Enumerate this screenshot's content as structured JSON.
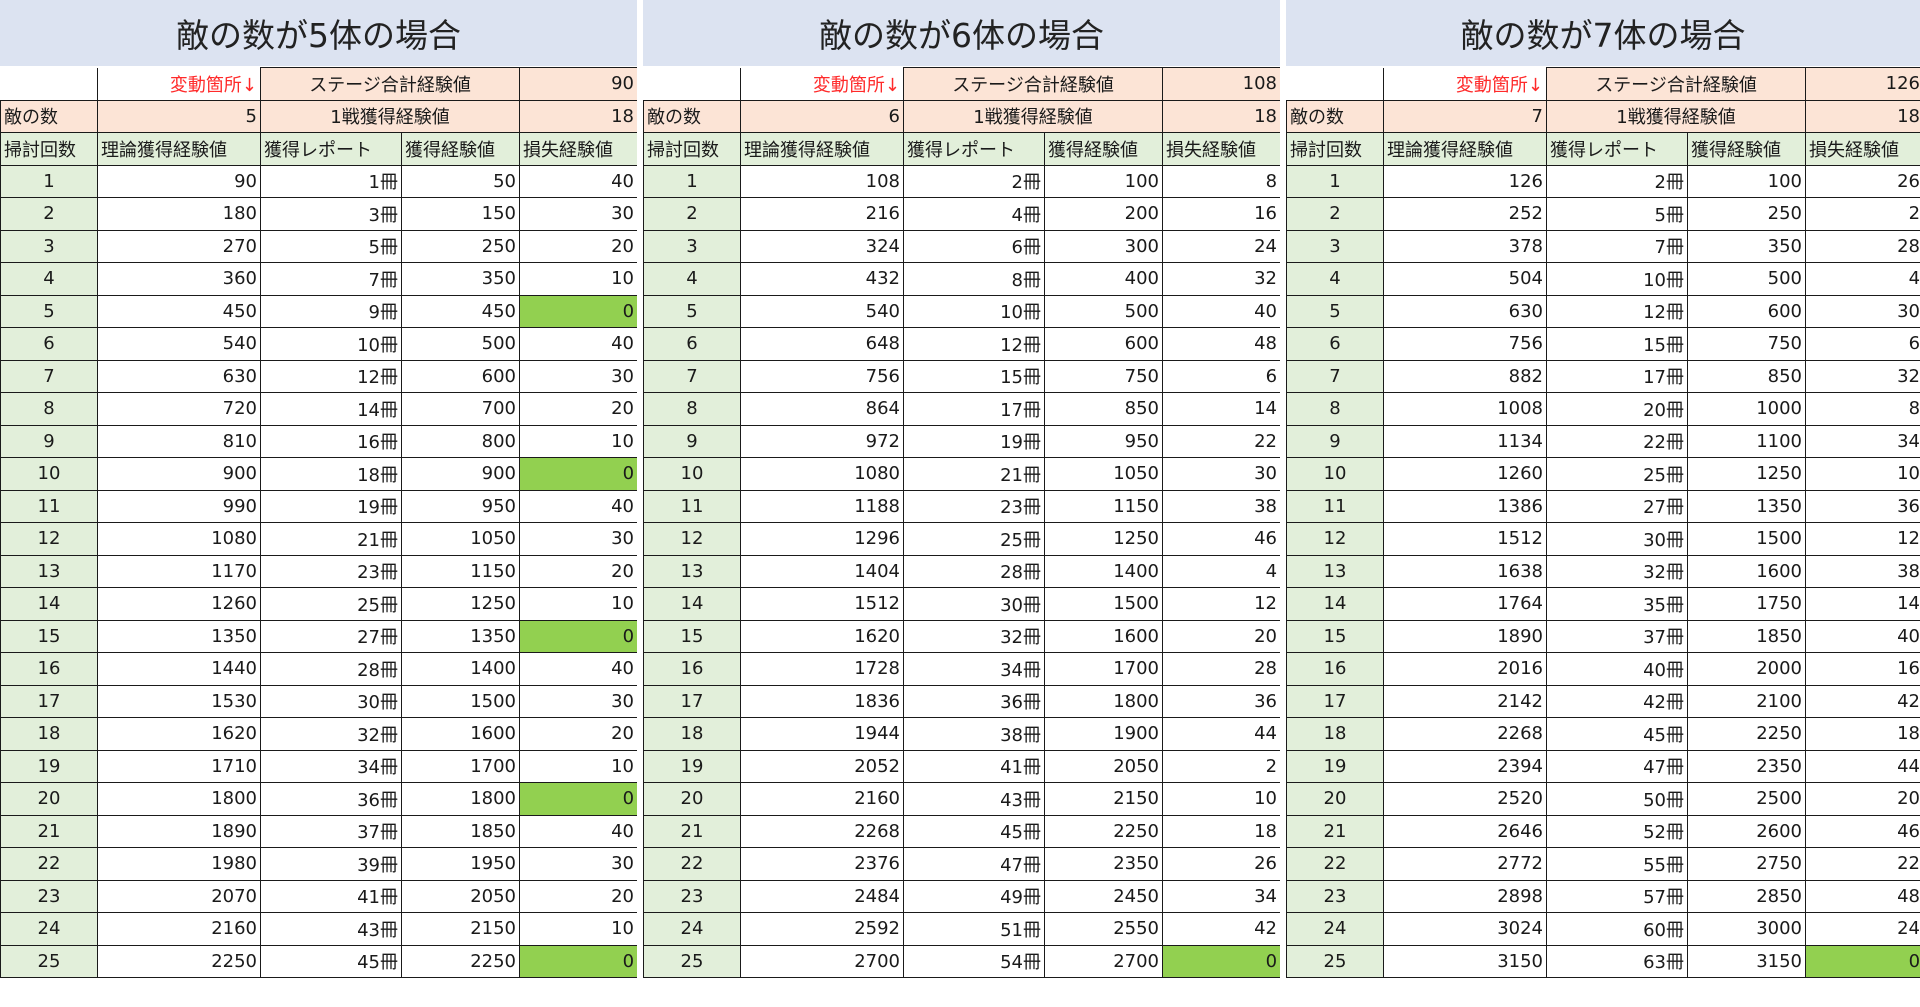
{
  "labels": {
    "variable_note": "変動箇所↓",
    "stage_total_label": "ステージ合計経験値",
    "enemy_count_label": "敵の数",
    "per_battle_label": "1戦獲得経験値",
    "col_sweeps": "掃討回数",
    "col_theory_exp": "理論獲得経験値",
    "col_reports": "獲得レポート",
    "col_gained_exp": "獲得経験値",
    "col_lost_exp": "損失経験値",
    "report_unit": "冊"
  },
  "colors": {
    "header_band": "#dce3f1",
    "label_fill": "#fce4d6",
    "index_fill": "#e2efda",
    "zero_loss_highlight": "#92d050",
    "note_text": "#ff2a2a"
  },
  "tables": [
    {
      "title": "敵の数が5体の場合",
      "stage_total": "90",
      "enemy_count": "5",
      "per_battle": "18",
      "rows": [
        {
          "sweeps": "1",
          "theory": "90",
          "reports": "1",
          "gained": "50",
          "lost": "40",
          "zero": false
        },
        {
          "sweeps": "2",
          "theory": "180",
          "reports": "3",
          "gained": "150",
          "lost": "30",
          "zero": false
        },
        {
          "sweeps": "3",
          "theory": "270",
          "reports": "5",
          "gained": "250",
          "lost": "20",
          "zero": false
        },
        {
          "sweeps": "4",
          "theory": "360",
          "reports": "7",
          "gained": "350",
          "lost": "10",
          "zero": false
        },
        {
          "sweeps": "5",
          "theory": "450",
          "reports": "9",
          "gained": "450",
          "lost": "0",
          "zero": true
        },
        {
          "sweeps": "6",
          "theory": "540",
          "reports": "10",
          "gained": "500",
          "lost": "40",
          "zero": false
        },
        {
          "sweeps": "7",
          "theory": "630",
          "reports": "12",
          "gained": "600",
          "lost": "30",
          "zero": false
        },
        {
          "sweeps": "8",
          "theory": "720",
          "reports": "14",
          "gained": "700",
          "lost": "20",
          "zero": false
        },
        {
          "sweeps": "9",
          "theory": "810",
          "reports": "16",
          "gained": "800",
          "lost": "10",
          "zero": false
        },
        {
          "sweeps": "10",
          "theory": "900",
          "reports": "18",
          "gained": "900",
          "lost": "0",
          "zero": true
        },
        {
          "sweeps": "11",
          "theory": "990",
          "reports": "19",
          "gained": "950",
          "lost": "40",
          "zero": false
        },
        {
          "sweeps": "12",
          "theory": "1080",
          "reports": "21",
          "gained": "1050",
          "lost": "30",
          "zero": false
        },
        {
          "sweeps": "13",
          "theory": "1170",
          "reports": "23",
          "gained": "1150",
          "lost": "20",
          "zero": false
        },
        {
          "sweeps": "14",
          "theory": "1260",
          "reports": "25",
          "gained": "1250",
          "lost": "10",
          "zero": false
        },
        {
          "sweeps": "15",
          "theory": "1350",
          "reports": "27",
          "gained": "1350",
          "lost": "0",
          "zero": true
        },
        {
          "sweeps": "16",
          "theory": "1440",
          "reports": "28",
          "gained": "1400",
          "lost": "40",
          "zero": false
        },
        {
          "sweeps": "17",
          "theory": "1530",
          "reports": "30",
          "gained": "1500",
          "lost": "30",
          "zero": false
        },
        {
          "sweeps": "18",
          "theory": "1620",
          "reports": "32",
          "gained": "1600",
          "lost": "20",
          "zero": false
        },
        {
          "sweeps": "19",
          "theory": "1710",
          "reports": "34",
          "gained": "1700",
          "lost": "10",
          "zero": false
        },
        {
          "sweeps": "20",
          "theory": "1800",
          "reports": "36",
          "gained": "1800",
          "lost": "0",
          "zero": true
        },
        {
          "sweeps": "21",
          "theory": "1890",
          "reports": "37",
          "gained": "1850",
          "lost": "40",
          "zero": false
        },
        {
          "sweeps": "22",
          "theory": "1980",
          "reports": "39",
          "gained": "1950",
          "lost": "30",
          "zero": false
        },
        {
          "sweeps": "23",
          "theory": "2070",
          "reports": "41",
          "gained": "2050",
          "lost": "20",
          "zero": false
        },
        {
          "sweeps": "24",
          "theory": "2160",
          "reports": "43",
          "gained": "2150",
          "lost": "10",
          "zero": false
        },
        {
          "sweeps": "25",
          "theory": "2250",
          "reports": "45",
          "gained": "2250",
          "lost": "0",
          "zero": true
        }
      ]
    },
    {
      "title": "敵の数が6体の場合",
      "stage_total": "108",
      "enemy_count": "6",
      "per_battle": "18",
      "rows": [
        {
          "sweeps": "1",
          "theory": "108",
          "reports": "2",
          "gained": "100",
          "lost": "8",
          "zero": false
        },
        {
          "sweeps": "2",
          "theory": "216",
          "reports": "4",
          "gained": "200",
          "lost": "16",
          "zero": false
        },
        {
          "sweeps": "3",
          "theory": "324",
          "reports": "6",
          "gained": "300",
          "lost": "24",
          "zero": false
        },
        {
          "sweeps": "4",
          "theory": "432",
          "reports": "8",
          "gained": "400",
          "lost": "32",
          "zero": false
        },
        {
          "sweeps": "5",
          "theory": "540",
          "reports": "10",
          "gained": "500",
          "lost": "40",
          "zero": false
        },
        {
          "sweeps": "6",
          "theory": "648",
          "reports": "12",
          "gained": "600",
          "lost": "48",
          "zero": false
        },
        {
          "sweeps": "7",
          "theory": "756",
          "reports": "15",
          "gained": "750",
          "lost": "6",
          "zero": false
        },
        {
          "sweeps": "8",
          "theory": "864",
          "reports": "17",
          "gained": "850",
          "lost": "14",
          "zero": false
        },
        {
          "sweeps": "9",
          "theory": "972",
          "reports": "19",
          "gained": "950",
          "lost": "22",
          "zero": false
        },
        {
          "sweeps": "10",
          "theory": "1080",
          "reports": "21",
          "gained": "1050",
          "lost": "30",
          "zero": false
        },
        {
          "sweeps": "11",
          "theory": "1188",
          "reports": "23",
          "gained": "1150",
          "lost": "38",
          "zero": false
        },
        {
          "sweeps": "12",
          "theory": "1296",
          "reports": "25",
          "gained": "1250",
          "lost": "46",
          "zero": false
        },
        {
          "sweeps": "13",
          "theory": "1404",
          "reports": "28",
          "gained": "1400",
          "lost": "4",
          "zero": false
        },
        {
          "sweeps": "14",
          "theory": "1512",
          "reports": "30",
          "gained": "1500",
          "lost": "12",
          "zero": false
        },
        {
          "sweeps": "15",
          "theory": "1620",
          "reports": "32",
          "gained": "1600",
          "lost": "20",
          "zero": false
        },
        {
          "sweeps": "16",
          "theory": "1728",
          "reports": "34",
          "gained": "1700",
          "lost": "28",
          "zero": false
        },
        {
          "sweeps": "17",
          "theory": "1836",
          "reports": "36",
          "gained": "1800",
          "lost": "36",
          "zero": false
        },
        {
          "sweeps": "18",
          "theory": "1944",
          "reports": "38",
          "gained": "1900",
          "lost": "44",
          "zero": false
        },
        {
          "sweeps": "19",
          "theory": "2052",
          "reports": "41",
          "gained": "2050",
          "lost": "2",
          "zero": false
        },
        {
          "sweeps": "20",
          "theory": "2160",
          "reports": "43",
          "gained": "2150",
          "lost": "10",
          "zero": false
        },
        {
          "sweeps": "21",
          "theory": "2268",
          "reports": "45",
          "gained": "2250",
          "lost": "18",
          "zero": false
        },
        {
          "sweeps": "22",
          "theory": "2376",
          "reports": "47",
          "gained": "2350",
          "lost": "26",
          "zero": false
        },
        {
          "sweeps": "23",
          "theory": "2484",
          "reports": "49",
          "gained": "2450",
          "lost": "34",
          "zero": false
        },
        {
          "sweeps": "24",
          "theory": "2592",
          "reports": "51",
          "gained": "2550",
          "lost": "42",
          "zero": false
        },
        {
          "sweeps": "25",
          "theory": "2700",
          "reports": "54",
          "gained": "2700",
          "lost": "0",
          "zero": true
        }
      ]
    },
    {
      "title": "敵の数が7体の場合",
      "stage_total": "126",
      "enemy_count": "7",
      "per_battle": "18",
      "rows": [
        {
          "sweeps": "1",
          "theory": "126",
          "reports": "2",
          "gained": "100",
          "lost": "26",
          "zero": false
        },
        {
          "sweeps": "2",
          "theory": "252",
          "reports": "5",
          "gained": "250",
          "lost": "2",
          "zero": false
        },
        {
          "sweeps": "3",
          "theory": "378",
          "reports": "7",
          "gained": "350",
          "lost": "28",
          "zero": false
        },
        {
          "sweeps": "4",
          "theory": "504",
          "reports": "10",
          "gained": "500",
          "lost": "4",
          "zero": false
        },
        {
          "sweeps": "5",
          "theory": "630",
          "reports": "12",
          "gained": "600",
          "lost": "30",
          "zero": false
        },
        {
          "sweeps": "6",
          "theory": "756",
          "reports": "15",
          "gained": "750",
          "lost": "6",
          "zero": false
        },
        {
          "sweeps": "7",
          "theory": "882",
          "reports": "17",
          "gained": "850",
          "lost": "32",
          "zero": false
        },
        {
          "sweeps": "8",
          "theory": "1008",
          "reports": "20",
          "gained": "1000",
          "lost": "8",
          "zero": false
        },
        {
          "sweeps": "9",
          "theory": "1134",
          "reports": "22",
          "gained": "1100",
          "lost": "34",
          "zero": false
        },
        {
          "sweeps": "10",
          "theory": "1260",
          "reports": "25",
          "gained": "1250",
          "lost": "10",
          "zero": false
        },
        {
          "sweeps": "11",
          "theory": "1386",
          "reports": "27",
          "gained": "1350",
          "lost": "36",
          "zero": false
        },
        {
          "sweeps": "12",
          "theory": "1512",
          "reports": "30",
          "gained": "1500",
          "lost": "12",
          "zero": false
        },
        {
          "sweeps": "13",
          "theory": "1638",
          "reports": "32",
          "gained": "1600",
          "lost": "38",
          "zero": false
        },
        {
          "sweeps": "14",
          "theory": "1764",
          "reports": "35",
          "gained": "1750",
          "lost": "14",
          "zero": false
        },
        {
          "sweeps": "15",
          "theory": "1890",
          "reports": "37",
          "gained": "1850",
          "lost": "40",
          "zero": false
        },
        {
          "sweeps": "16",
          "theory": "2016",
          "reports": "40",
          "gained": "2000",
          "lost": "16",
          "zero": false
        },
        {
          "sweeps": "17",
          "theory": "2142",
          "reports": "42",
          "gained": "2100",
          "lost": "42",
          "zero": false
        },
        {
          "sweeps": "18",
          "theory": "2268",
          "reports": "45",
          "gained": "2250",
          "lost": "18",
          "zero": false
        },
        {
          "sweeps": "19",
          "theory": "2394",
          "reports": "47",
          "gained": "2350",
          "lost": "44",
          "zero": false
        },
        {
          "sweeps": "20",
          "theory": "2520",
          "reports": "50",
          "gained": "2500",
          "lost": "20",
          "zero": false
        },
        {
          "sweeps": "21",
          "theory": "2646",
          "reports": "52",
          "gained": "2600",
          "lost": "46",
          "zero": false
        },
        {
          "sweeps": "22",
          "theory": "2772",
          "reports": "55",
          "gained": "2750",
          "lost": "22",
          "zero": false
        },
        {
          "sweeps": "23",
          "theory": "2898",
          "reports": "57",
          "gained": "2850",
          "lost": "48",
          "zero": false
        },
        {
          "sweeps": "24",
          "theory": "3024",
          "reports": "60",
          "gained": "3000",
          "lost": "24",
          "zero": false
        },
        {
          "sweeps": "25",
          "theory": "3150",
          "reports": "63",
          "gained": "3150",
          "lost": "0",
          "zero": true
        }
      ]
    }
  ]
}
